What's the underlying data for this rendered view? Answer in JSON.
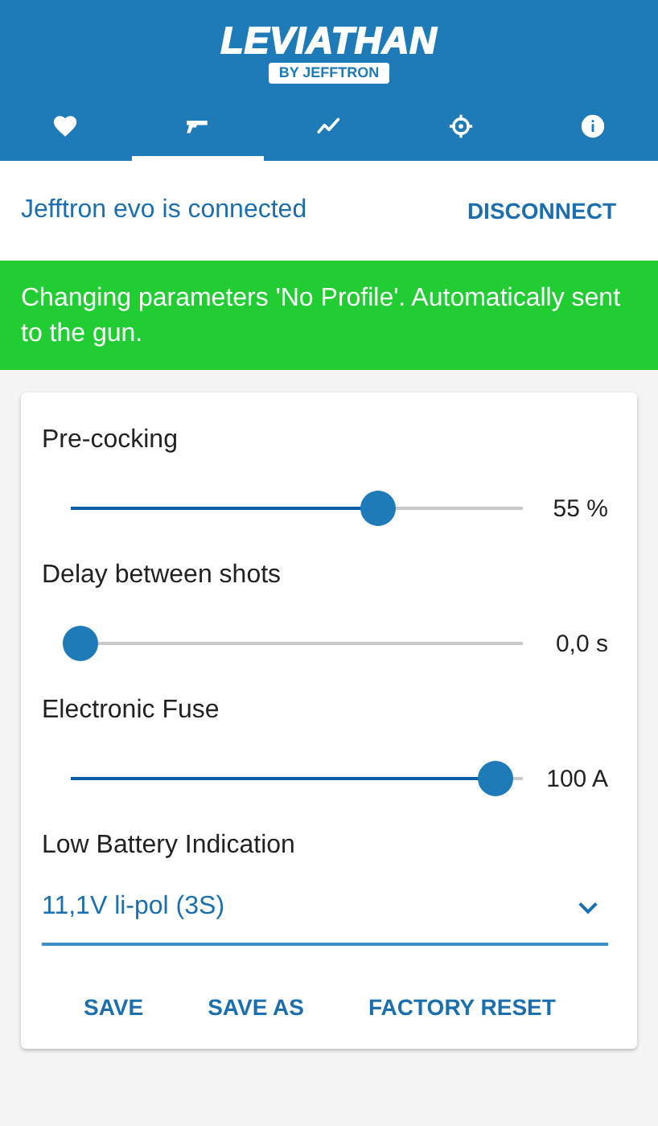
{
  "header": {
    "logo_title": "LEVIATHAN",
    "logo_subtitle": "BY JEFFTRON"
  },
  "tabs": [
    {
      "kind": "heart",
      "selected": false
    },
    {
      "kind": "pistol",
      "selected": true
    },
    {
      "kind": "trend",
      "selected": false
    },
    {
      "kind": "crosshair",
      "selected": false
    },
    {
      "kind": "info",
      "selected": false
    }
  ],
  "connection": {
    "status": "Jefftron evo is connected",
    "action": "DISCONNECT"
  },
  "banner": {
    "message": "Changing parameters 'No Profile'. Automatically sent to the gun."
  },
  "sliders": [
    {
      "label": "Pre-cocking",
      "level": 0.68,
      "reading": "55 %"
    },
    {
      "label": "Delay between shots",
      "level": 0.02,
      "reading": "0,0 s"
    },
    {
      "label": "Electronic Fuse",
      "level": 0.94,
      "reading": "100 A"
    }
  ],
  "select": {
    "label": "Low Battery Indication",
    "value": "11,1V li-pol (3S)"
  },
  "buttons": [
    "SAVE",
    "SAVE AS",
    "FACTORY RESET"
  ]
}
